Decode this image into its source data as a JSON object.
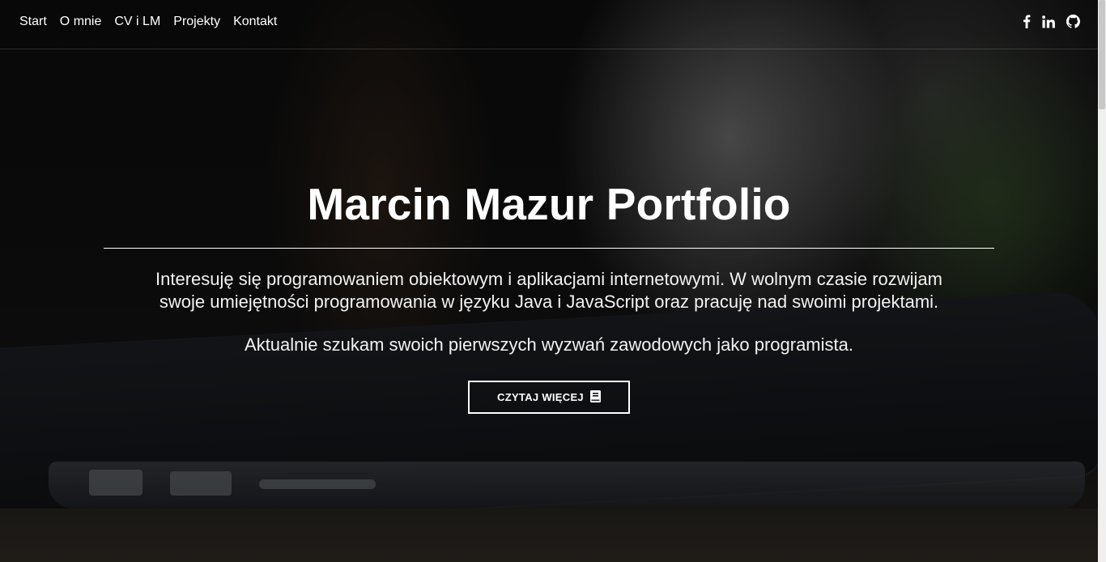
{
  "nav": {
    "items": [
      "Start",
      "O mnie",
      "CV i LM",
      "Projekty",
      "Kontakt"
    ],
    "social": [
      "facebook-icon",
      "linkedin-icon",
      "github-icon"
    ]
  },
  "hero": {
    "title": "Marcin Mazur Portfolio",
    "intro_line1": "Interesuję się programowaniem obiektowym i aplikacjami internetowymi. W wolnym czasie rozwijam",
    "intro_line2": "swoje umiejętności programowania w języku Java i JavaScript oraz pracuję nad swoimi projektami.",
    "second": "Aktualnie szukam swoich pierwszych wyzwań zawodowych jako programista.",
    "button_label": "CZYTAJ WIĘCEJ",
    "button_icon": "book-icon"
  }
}
